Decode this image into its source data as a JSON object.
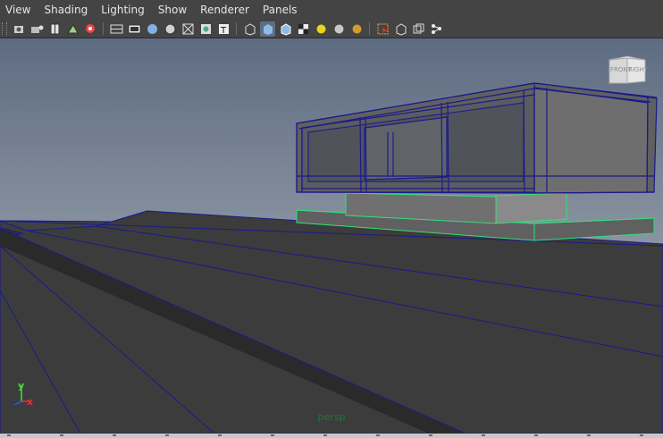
{
  "menu": {
    "items": [
      "View",
      "Shading",
      "Lighting",
      "Show",
      "Renderer",
      "Panels"
    ]
  },
  "toolbar": {
    "icons": [
      "camera-attributes-icon",
      "camera-tumble-icon",
      "film-gate-icon",
      "image-plane-icon",
      "bookmark-icon",
      "wireframe-grid-icon",
      "resolution-gate-icon",
      "smooth-shade-icon",
      "flat-shade-icon",
      "bounding-box-icon",
      "texture-icon",
      "text-icon",
      "wireframe-cube-icon",
      "shaded-cube-icon",
      "shaded-wireframe-icon",
      "checker-texture-icon",
      "default-light-icon",
      "all-lights-icon",
      "shadows-icon",
      "isolate-select-icon",
      "xray-icon",
      "xray-joints-icon",
      "graph-icon"
    ]
  },
  "viewport": {
    "camera_label": "persp",
    "viewcube": {
      "front_label": "FRONT",
      "right_label": "RIGHT"
    },
    "axes": {
      "x_label": "x",
      "y_label": "y"
    }
  },
  "colors": {
    "selected_wire": "#1a1a8c",
    "highlight_wire": "#33e07a",
    "sky_top": "#5a6a82",
    "sky_bottom": "#9aa3ad",
    "ground": "#353535"
  }
}
